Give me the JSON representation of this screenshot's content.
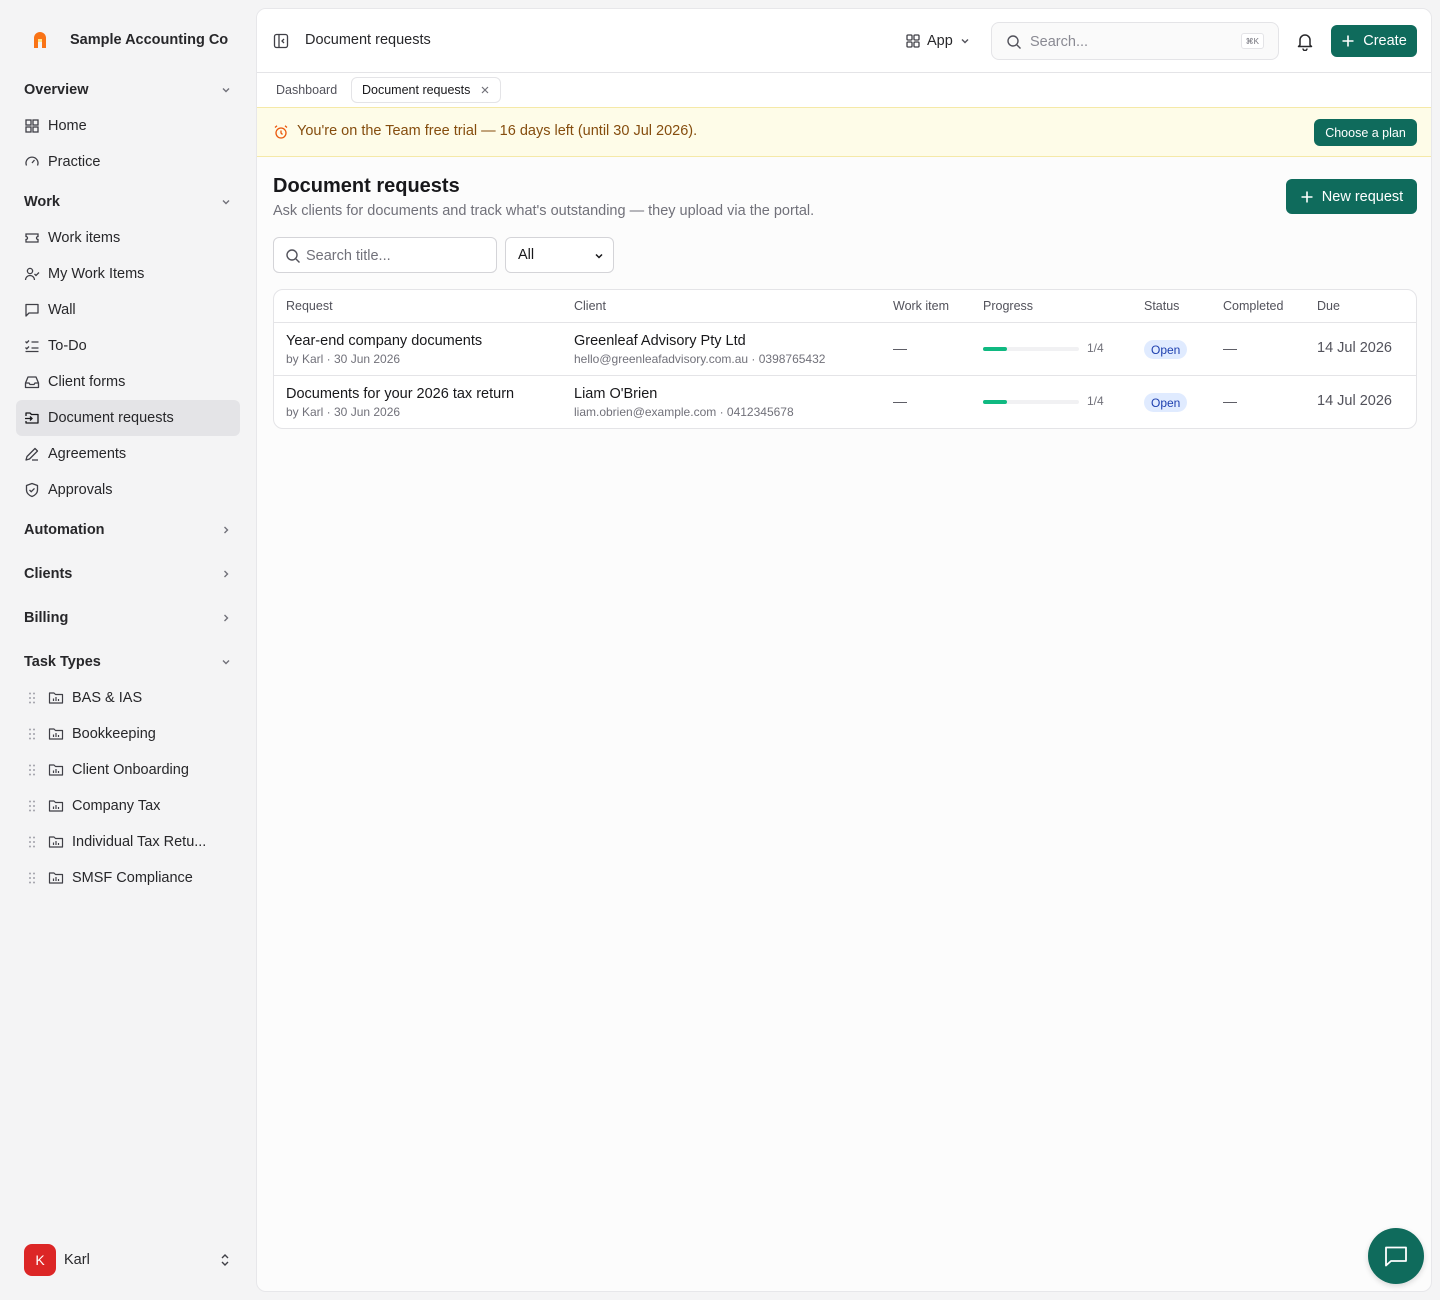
{
  "org": {
    "name": "Sample Accounting Co"
  },
  "sidebar": {
    "groups": [
      {
        "label": "Overview",
        "items": [
          {
            "label": "Home"
          },
          {
            "label": "Practice"
          }
        ]
      },
      {
        "label": "Work",
        "items": [
          {
            "label": "Work items"
          },
          {
            "label": "My Work Items"
          },
          {
            "label": "Wall"
          },
          {
            "label": "To-Do"
          },
          {
            "label": "Client forms"
          },
          {
            "label": "Document requests",
            "active": true
          },
          {
            "label": "Agreements"
          },
          {
            "label": "Approvals"
          }
        ]
      },
      {
        "label": "Automation"
      },
      {
        "label": "Clients"
      },
      {
        "label": "Billing"
      },
      {
        "label": "Task Types",
        "items": [
          {
            "label": "BAS & IAS"
          },
          {
            "label": "Bookkeeping"
          },
          {
            "label": "Client Onboarding"
          },
          {
            "label": "Company Tax"
          },
          {
            "label": "Individual Tax Retu..."
          },
          {
            "label": "SMSF Compliance"
          }
        ]
      }
    ]
  },
  "user": {
    "name": "Karl",
    "initial": "K"
  },
  "topbar": {
    "title": "Document requests",
    "app_label": "App",
    "search_placeholder": "Search...",
    "shortcut": "⌘K",
    "create_label": "Create"
  },
  "tabs": [
    {
      "label": "Dashboard"
    },
    {
      "label": "Document requests"
    }
  ],
  "trial": {
    "text": "You're on the Team free trial — 16 days left (until 30 Jul 2026).",
    "button": "Choose a plan"
  },
  "page": {
    "title": "Document requests",
    "subtitle": "Ask clients for documents and track what's outstanding — they upload via the portal.",
    "new_button": "New request",
    "filter_placeholder": "Search title...",
    "status_filter": "All"
  },
  "table": {
    "columns": [
      "Request",
      "Client",
      "Work item",
      "Progress",
      "Status",
      "Completed",
      "Due"
    ],
    "rows": [
      {
        "title": "Year-end company documents",
        "meta": "by Karl · 30 Jun 2026",
        "client": "Greenleaf Advisory Pty Ltd",
        "client_contact": "hello@greenleafadvisory.com.au · 0398765432",
        "work_item": "—",
        "progress_done": 1,
        "progress_total": 4,
        "progress_label": "1/4",
        "status": "Open",
        "completed": "—",
        "due": "14 Jul 2026"
      },
      {
        "title": "Documents for your 2026 tax return",
        "meta": "by Karl · 30 Jun 2026",
        "client": "Liam O'Brien",
        "client_contact": "liam.obrien@example.com · 0412345678",
        "work_item": "—",
        "progress_done": 1,
        "progress_total": 4,
        "progress_label": "1/4",
        "status": "Open",
        "completed": "—",
        "due": "14 Jul 2026"
      }
    ]
  },
  "colors": {
    "accent": "#0f6b5c",
    "progress": "#10b981",
    "trial_bg": "#fefce8",
    "avatar": "#dc2626"
  }
}
